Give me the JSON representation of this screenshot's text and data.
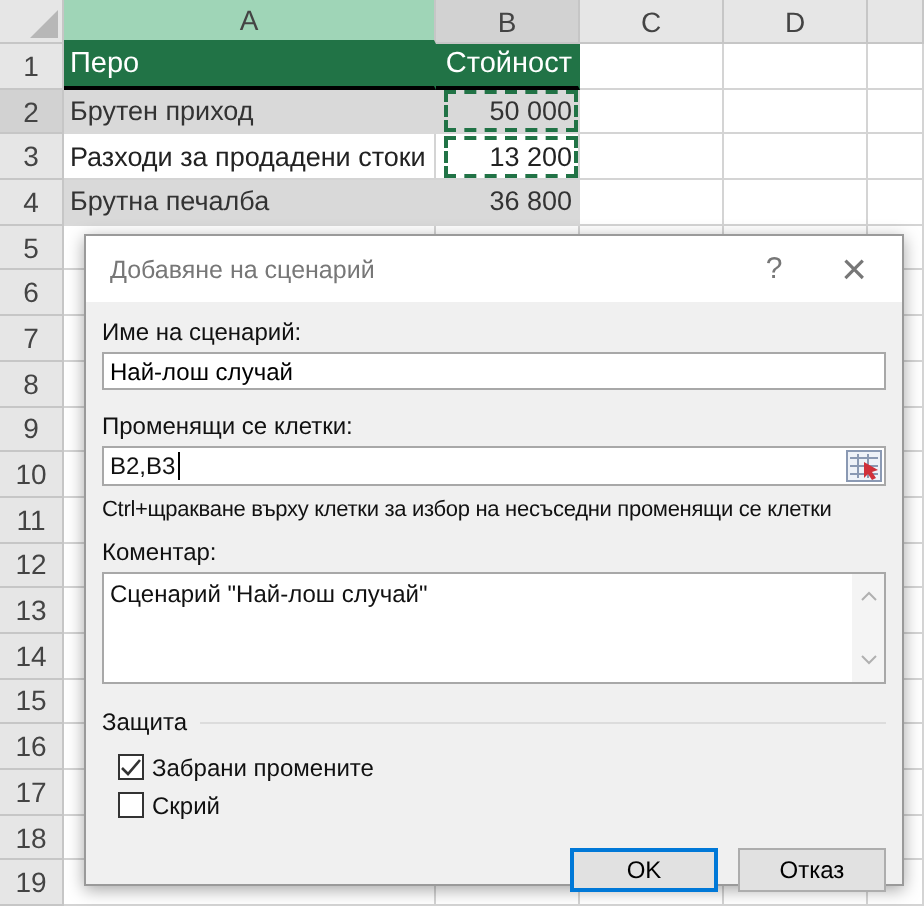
{
  "sheet": {
    "columns": [
      {
        "label": "A",
        "kind": "active"
      },
      {
        "label": "B",
        "kind": "range"
      },
      {
        "label": "C",
        "kind": "plain"
      },
      {
        "label": "D",
        "kind": "plain"
      },
      {
        "kind": "plain"
      }
    ],
    "rows": [
      {
        "number": "1",
        "selected": false,
        "kind": "header",
        "cells": [
          {
            "text": "Перо",
            "marquee": false
          },
          {
            "text": "Стойност",
            "marquee": false
          }
        ]
      },
      {
        "number": "2",
        "selected": true,
        "kind": "band",
        "cells": [
          {
            "text": "Брутен приход",
            "marquee": false
          },
          {
            "text": "50 000",
            "marquee": true
          }
        ]
      },
      {
        "number": "3",
        "selected": false,
        "kind": "plain",
        "cells": [
          {
            "text": "Разходи за продадени стоки",
            "marquee": false
          },
          {
            "text": "13 200",
            "marquee": true
          }
        ]
      },
      {
        "number": "4",
        "selected": false,
        "kind": "band",
        "cells": [
          {
            "text": "Брутна печалба",
            "marquee": false
          },
          {
            "text": "36 800",
            "marquee": false
          }
        ]
      },
      {
        "number": "5",
        "selected": false
      },
      {
        "number": "6",
        "selected": false
      },
      {
        "number": "7",
        "selected": false
      },
      {
        "number": "8",
        "selected": false
      },
      {
        "number": "9",
        "selected": false
      },
      {
        "number": "10",
        "selected": false
      },
      {
        "number": "11",
        "selected": false
      },
      {
        "number": "12",
        "selected": false
      },
      {
        "number": "13",
        "selected": false
      },
      {
        "number": "14",
        "selected": false
      },
      {
        "number": "15",
        "selected": false
      },
      {
        "number": "16",
        "selected": false
      },
      {
        "number": "17",
        "selected": false
      },
      {
        "number": "18",
        "selected": false
      },
      {
        "number": "19",
        "selected": false
      }
    ]
  },
  "dialog": {
    "title": "Добавяне на сценарий",
    "help": "?",
    "close": "×",
    "name_label": "Име на сценарий:",
    "name_value": "Най-лош случай",
    "cells_label": "Променящи се клетки:",
    "cells_value": "B2,B3",
    "hint": "Ctrl+щракване върху клетки за избор на несъседни променящи се клетки",
    "comment_label": "Коментар:",
    "comment_value": "Сценарий \"Най-лош случай\"",
    "group_label": "Защита",
    "checkboxes": [
      {
        "label": "Забрани промените",
        "checked": true
      },
      {
        "label": "Скрий",
        "checked": false
      }
    ],
    "buttons": [
      {
        "label": "OK",
        "default": true
      },
      {
        "label": "Отказ",
        "default": false
      }
    ]
  }
}
